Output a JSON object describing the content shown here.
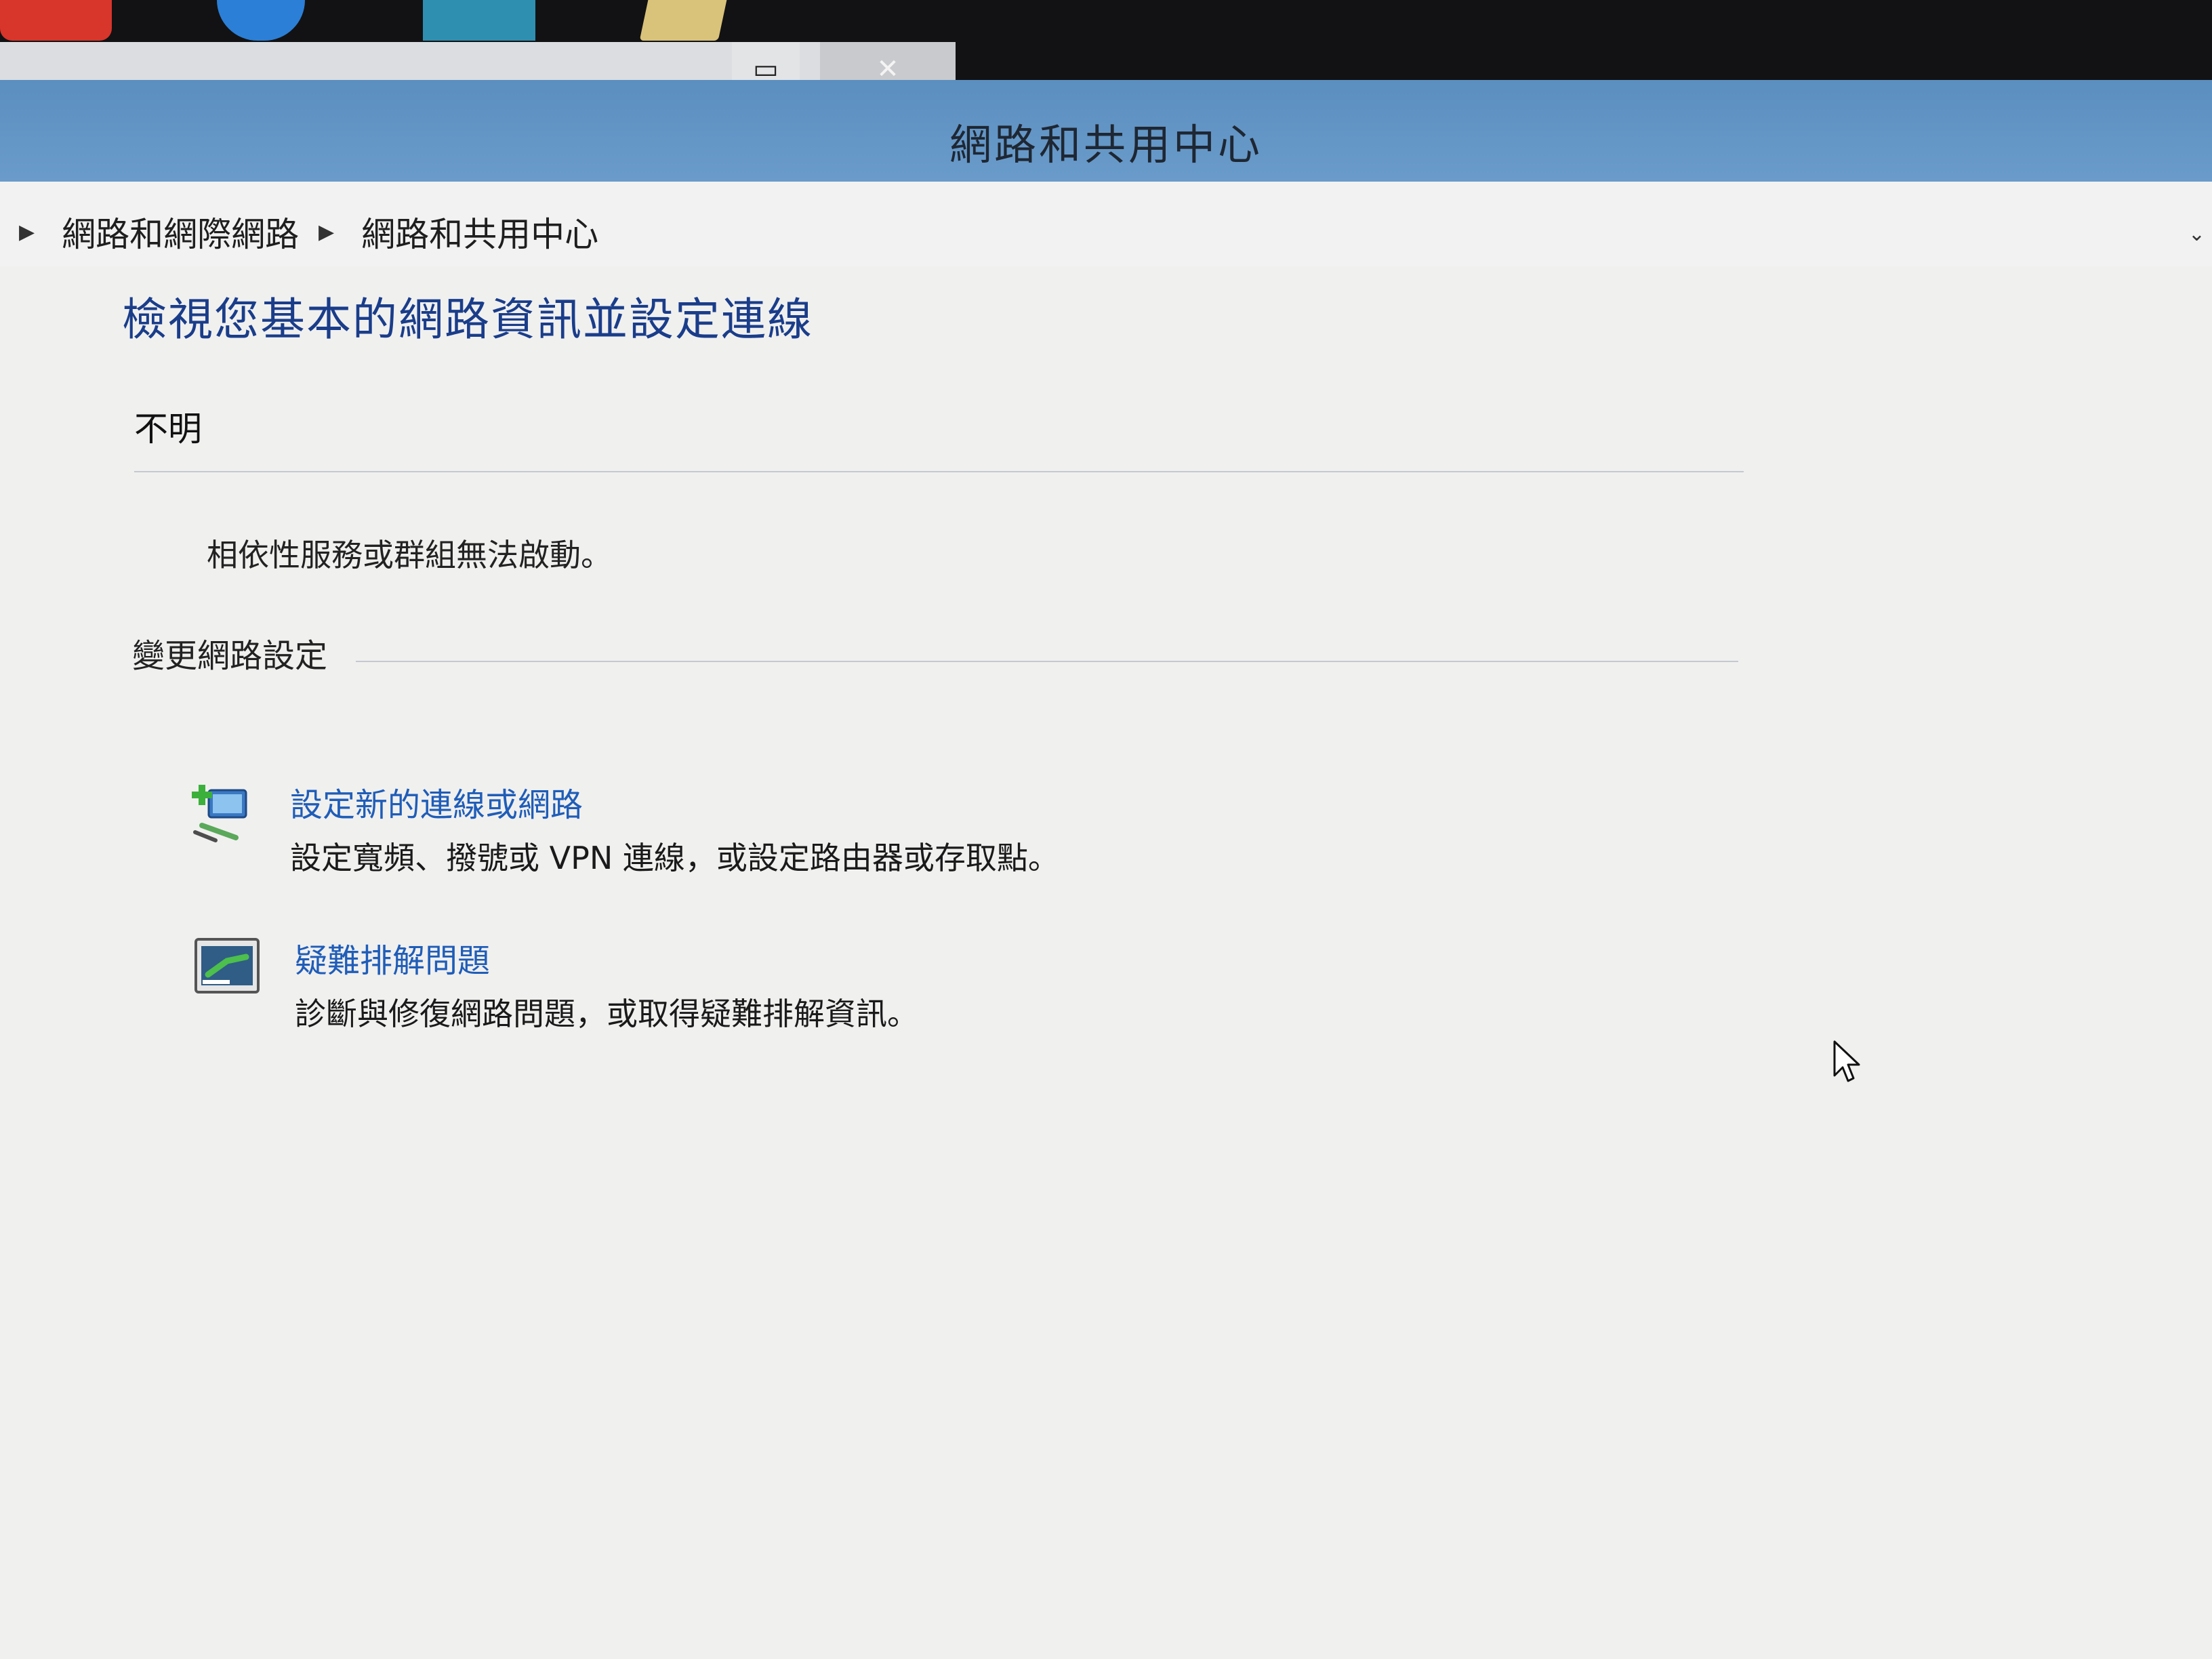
{
  "window": {
    "title": "網路和共用中心"
  },
  "breadcrumb": {
    "items": [
      {
        "label": "網路和網際網路"
      },
      {
        "label": "網路和共用中心"
      }
    ]
  },
  "main": {
    "heading": "檢視您基本的網路資訊並設定連線",
    "network_name": "不明",
    "status_message": "相依性服務或群組無法啟動。",
    "change_settings_label": "變更網路設定",
    "tasks": [
      {
        "link": "設定新的連線或網路",
        "description": "設定寬頻、撥號或 VPN 連線，或設定路由器或存取點。",
        "icon": "new-connection-icon"
      },
      {
        "link": "疑難排解問題",
        "description": "診斷與修復網路問題，或取得疑難排解資訊。",
        "icon": "troubleshoot-icon"
      }
    ]
  },
  "colors": {
    "titlebar": "#5b8fc0",
    "heading": "#1a3d8a",
    "link": "#1f5db8"
  }
}
